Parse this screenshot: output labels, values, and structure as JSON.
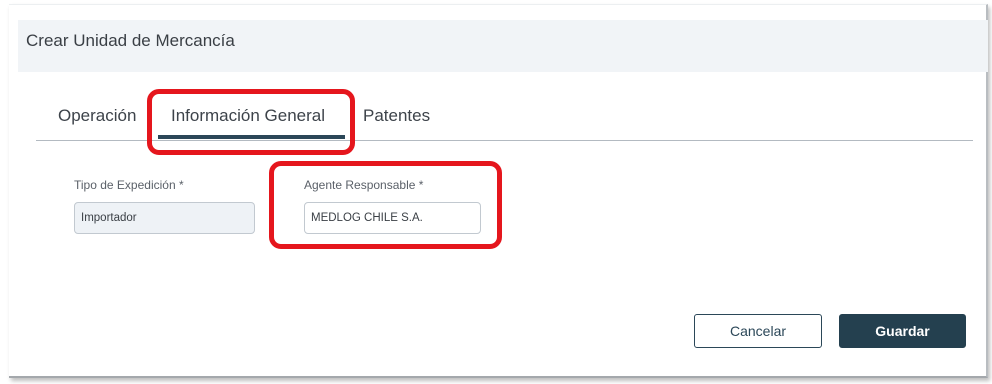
{
  "dialog": {
    "title": "Crear Unidad de Mercancía"
  },
  "tabs": [
    {
      "label": "Operación",
      "active": false
    },
    {
      "label": "Información General",
      "active": true
    },
    {
      "label": "Patentes",
      "active": false
    }
  ],
  "form": {
    "tipo_expedicion": {
      "label": "Tipo de Expedición *",
      "value": "Importador",
      "readonly": true
    },
    "agente_responsable": {
      "label": "Agente Responsable *",
      "value": "MEDLOG CHILE S.A."
    }
  },
  "actions": {
    "cancel_label": "Cancelar",
    "save_label": "Guardar"
  },
  "colors": {
    "accent": "#24404f",
    "highlight": "#e5161d",
    "header_bg": "#f1f4f7"
  }
}
